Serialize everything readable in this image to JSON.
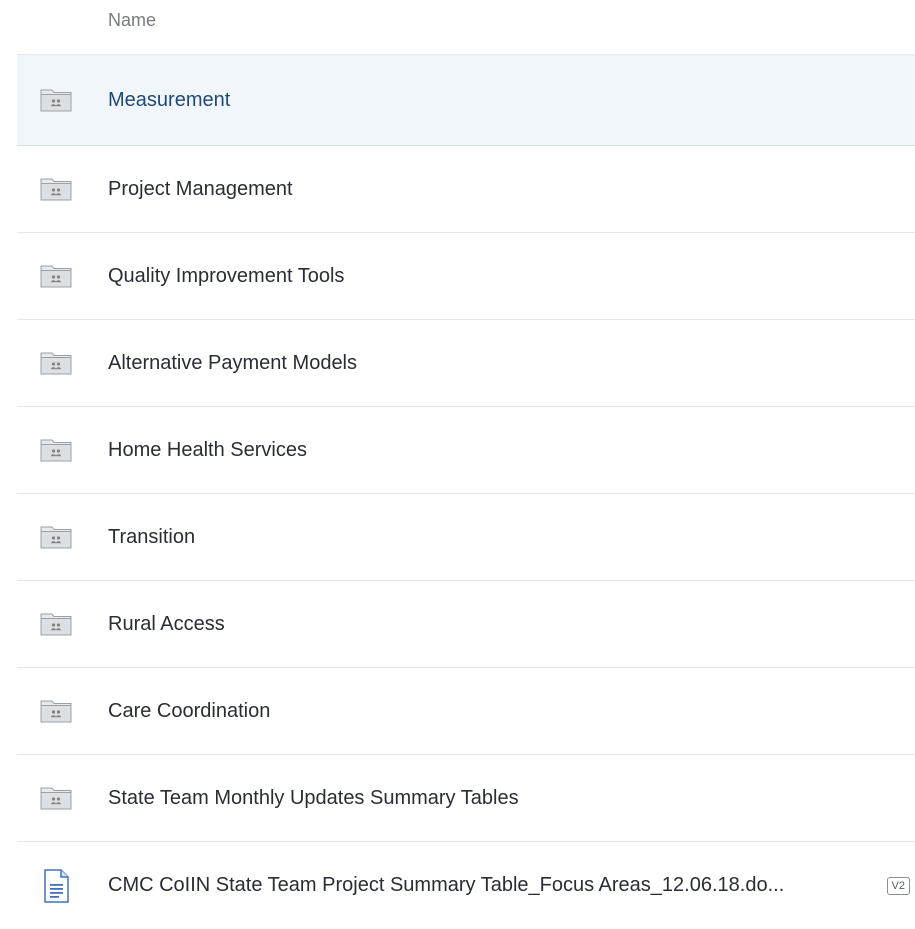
{
  "header": {
    "name_column": "Name"
  },
  "items": [
    {
      "label": "Measurement",
      "icon": "shared-folder-icon",
      "selected": true
    },
    {
      "label": "Project Management",
      "icon": "shared-folder-icon"
    },
    {
      "label": "Quality Improvement Tools",
      "icon": "shared-folder-icon"
    },
    {
      "label": "Alternative Payment Models",
      "icon": "shared-folder-icon"
    },
    {
      "label": "Home Health Services",
      "icon": "shared-folder-icon"
    },
    {
      "label": "Transition",
      "icon": "shared-folder-icon"
    },
    {
      "label": "Rural Access",
      "icon": "shared-folder-icon"
    },
    {
      "label": "Care Coordination",
      "icon": "shared-folder-icon"
    },
    {
      "label": "State Team Monthly Updates Summary Tables",
      "icon": "shared-folder-icon"
    },
    {
      "label": "CMC CoIIN State Team Project Summary Table_Focus Areas_12.06.18.do...",
      "icon": "document-file-icon",
      "version": "V2"
    }
  ],
  "colors": {
    "selected_bg": "#f1f6fb",
    "selected_text": "#1f4a78",
    "folder_fill": "#d6d9dc",
    "document_accent": "#3f72c4"
  }
}
